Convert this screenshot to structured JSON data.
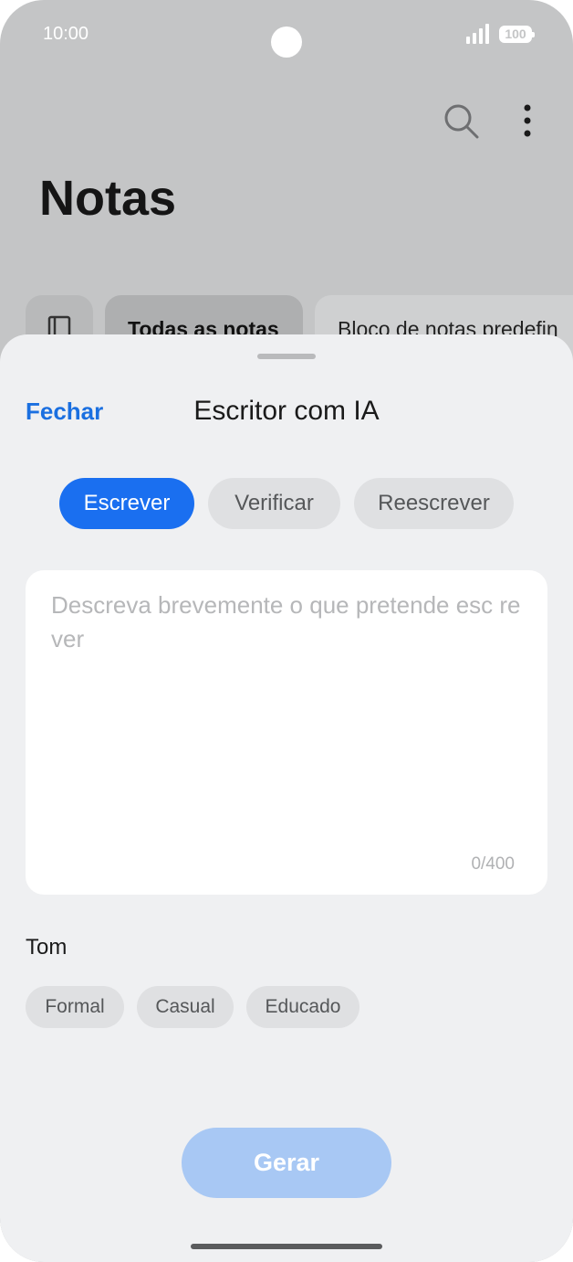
{
  "status_bar": {
    "time": "10:00",
    "battery": "100"
  },
  "app": {
    "title": "Notas",
    "icons": [
      "search-icon",
      "more-vert-icon",
      "notebook-icon"
    ],
    "filters": {
      "all": "Todas as notas",
      "default": "Bloco de notas predefin"
    }
  },
  "sheet": {
    "close_label": "Fechar",
    "title": "Escritor com IA",
    "tabs": [
      {
        "label": "Escrever",
        "active": true
      },
      {
        "label": "Verificar",
        "active": false
      },
      {
        "label": "Reescrever",
        "active": false
      }
    ],
    "input": {
      "placeholder": "Descreva brevemente o que pretende esc rever",
      "counter": "0/400"
    },
    "tone": {
      "label": "Tom",
      "options": [
        "Formal",
        "Casual",
        "Educado"
      ]
    },
    "generate_label": "Gerar"
  },
  "colors": {
    "accent": "#1a6ff0",
    "link": "#1a6fe0",
    "disabled_button": "#a8c8f4",
    "sheet_bg": "#eff0f2"
  }
}
